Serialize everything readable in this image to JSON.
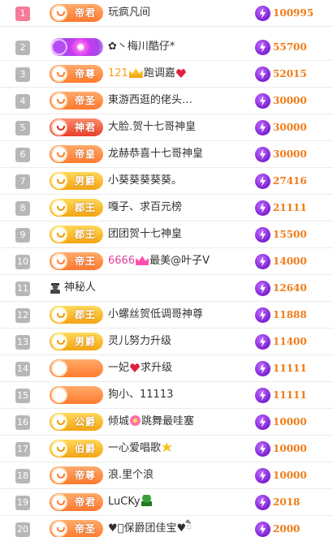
{
  "rows": [
    {
      "rank": "1",
      "badge": "帝君",
      "badge_style": "orange",
      "name": "玩疯凡间",
      "score": "100995"
    },
    {
      "rank": "2",
      "badge": "",
      "badge_style": "purple",
      "name": "✿丶梅川酷仔*",
      "score": "55700"
    },
    {
      "rank": "3",
      "badge": "帝尊",
      "badge_style": "orange",
      "name_lvl": "121",
      "name": "跑调嘉",
      "score": "52015"
    },
    {
      "rank": "4",
      "badge": "帝圣",
      "badge_style": "orange",
      "name": "東游西逛的佬头…",
      "score": "30000"
    },
    {
      "rank": "5",
      "badge": "神君",
      "badge_style": "red",
      "name": "大脸.贺十七哥神皇",
      "score": "30000"
    },
    {
      "rank": "6",
      "badge": "帝皇",
      "badge_style": "orange",
      "name": "龙赫恭喜十七哥神皇",
      "score": "30000"
    },
    {
      "rank": "7",
      "badge": "男爵",
      "badge_style": "gold",
      "name": "小葵葵葵葵葵。",
      "score": "27416"
    },
    {
      "rank": "8",
      "badge": "郡王",
      "badge_style": "gold",
      "name": "嘎子、求百元榜",
      "score": "21111"
    },
    {
      "rank": "9",
      "badge": "郡王",
      "badge_style": "gold",
      "name": "团团贺十七神皇",
      "score": "15500"
    },
    {
      "rank": "10",
      "badge": "帝王",
      "badge_style": "orange",
      "name_lvl": "6666",
      "name": "最美@叶子V",
      "score": "14000"
    },
    {
      "rank": "11",
      "badge": "",
      "badge_style": "none",
      "name": "神秘人",
      "score": "12640"
    },
    {
      "rank": "12",
      "badge": "郡王",
      "badge_style": "gold",
      "name": "小螺丝贺低调哥神尊",
      "score": "11888"
    },
    {
      "rank": "13",
      "badge": "男爵",
      "badge_style": "gold",
      "name": "灵儿努力升级",
      "score": "11400"
    },
    {
      "rank": "14",
      "badge": "",
      "badge_style": "orange",
      "name_pre": "一妃",
      "name": "求升级",
      "score": "11111"
    },
    {
      "rank": "15",
      "badge": "",
      "badge_style": "orange",
      "name": "狗小、11113",
      "score": "11111"
    },
    {
      "rank": "16",
      "badge": "公爵",
      "badge_style": "gold",
      "name_pre": "倾城",
      "name": "跳舞最哇塞",
      "score": "10000"
    },
    {
      "rank": "17",
      "badge": "伯爵",
      "badge_style": "gold",
      "name": "一心爱唱歌",
      "score": "10000"
    },
    {
      "rank": "18",
      "badge": "帝尊",
      "badge_style": "orange",
      "name": "浪.里个浪",
      "score": "10000"
    },
    {
      "rank": "19",
      "badge": "帝君",
      "badge_style": "orange",
      "name": "LuCKy",
      "score": "2018"
    },
    {
      "rank": "20",
      "badge": "帝圣",
      "badge_style": "orange",
      "name": "♥ཻ保爵团佳宝♥ཻ",
      "score": "2000"
    }
  ],
  "icons": {
    "score_icon": "lightning-coin-icon",
    "level_badge_icon": "crown-emblem-icon",
    "mystery_user_icon": "detective-icon"
  },
  "colors": {
    "rank_top": "#f57b98",
    "rank_default": "#b7b7b7",
    "score_text": "#f07b16",
    "lightning_coin": "#8a2be2",
    "badge_orange": "#ff7a2e",
    "badge_gold": "#f4a412",
    "badge_red": "#e8402a"
  }
}
